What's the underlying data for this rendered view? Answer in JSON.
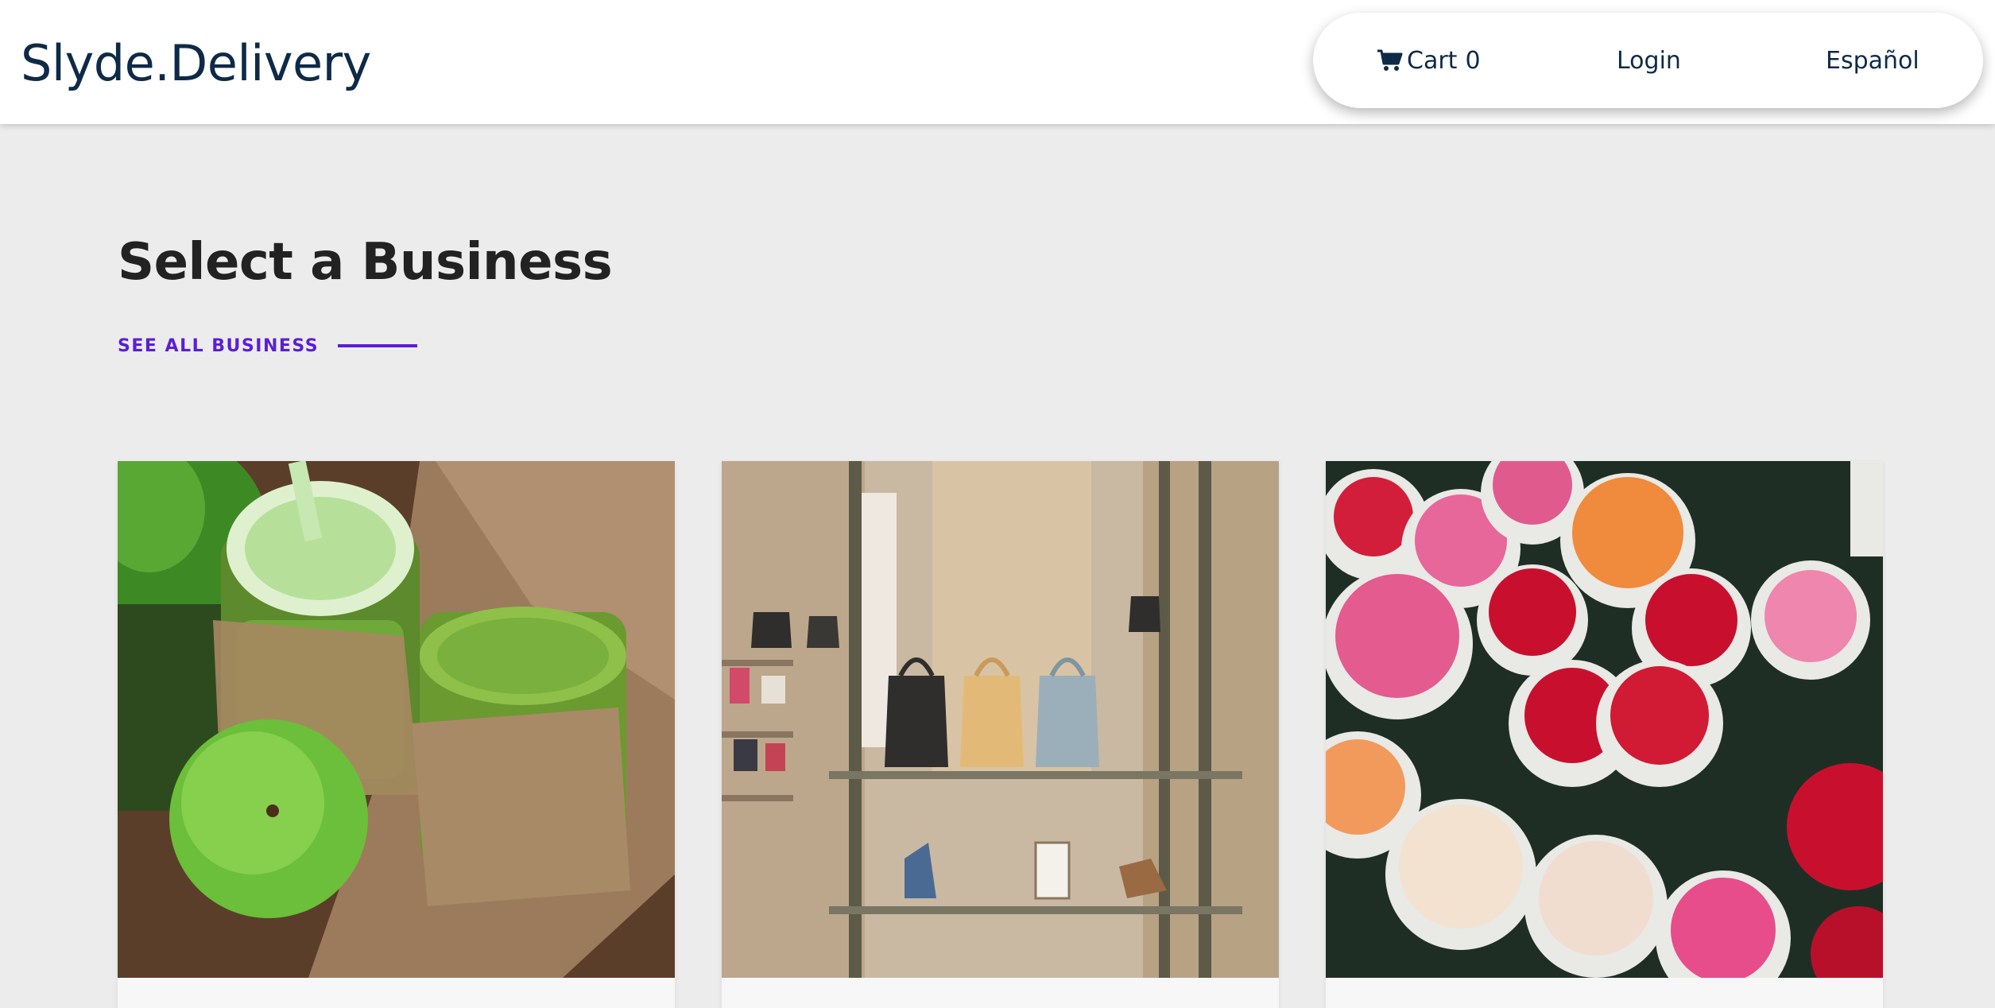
{
  "header": {
    "brand": "Slyde.Delivery",
    "nav": {
      "cart_label": "Cart",
      "cart_count": "0",
      "login_label": "Login",
      "language_label": "Español"
    }
  },
  "main": {
    "section_title": "Select a Business",
    "see_all_label": "SEE ALL BUSINESS",
    "businesses": [
      {
        "image": "green-smoothie-jars-image"
      },
      {
        "image": "handbag-boutique-image"
      },
      {
        "image": "flower-bouquets-image"
      }
    ]
  },
  "colors": {
    "brand": "#0e2a47",
    "accent": "#5a1ed6",
    "background": "#ececec",
    "title": "#222222"
  },
  "icons": {
    "cart": "cart-icon"
  }
}
